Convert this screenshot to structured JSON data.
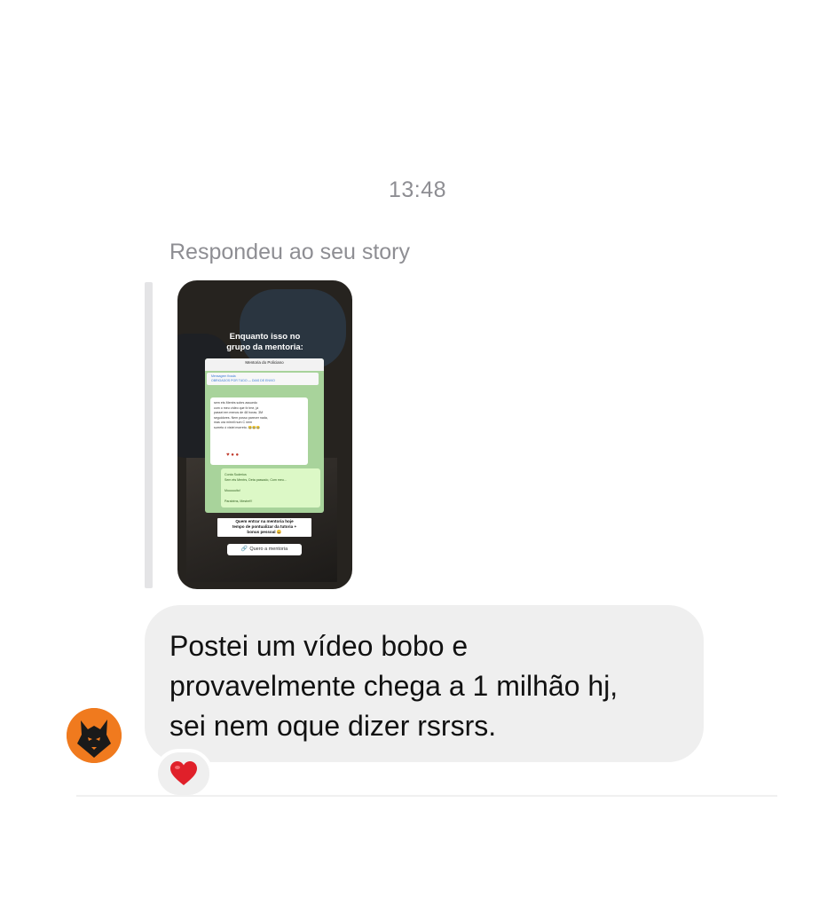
{
  "timestamp": "13:48",
  "reply_label": "Respondeu ao seu story",
  "story": {
    "title": "Enquanto isso no\ngrupo da mentoria:",
    "chat_header": "Mentoria do Policiano",
    "pinned_text": "Mensagem fixada\nOBRIGADOS POR TUDO — DIAS DE ENVIO",
    "bubble1_text": "sem ets Mentrs sobrs assuedo\ncom o meu vídeo que fz tme, já\npassei em menos de 48 horas. 3M\nseguidores. Nem posso parecer nada,\nmas ura mimril num C nem\nsurreto ó vistei morreto. 😂😂😂",
    "bubble2_text": "Conta Suderius\nSem ets Mentrs, Deta passado, Com meu...\n\nMuuuuuito!\n\nParabéns, Mestre!!!",
    "caption": "Quem entrar na mentoria hoje\ntempo de pontualizar da tutoria +\nbonus pessoal 😀",
    "link_label": "Quero a mentoria",
    "accent_color": "#a8d39b"
  },
  "message": {
    "text": "Postei um vídeo bobo e\nprovavelmente chega a 1 milhão hj,\nsei nem oque dizer rsrsrs.",
    "bubble_color": "#efefef"
  },
  "reaction": {
    "emoji": "❤️",
    "color": "#e0202a"
  },
  "avatar": {
    "icon": "wolf-icon",
    "color": "#f07a1e"
  }
}
